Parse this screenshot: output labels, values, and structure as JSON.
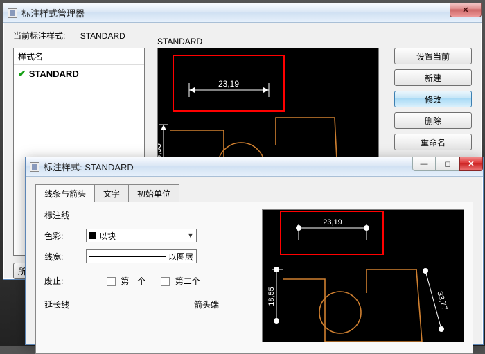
{
  "manager": {
    "title": "标注样式管理器",
    "current_label": "当前标注样式:",
    "current_value": "STANDARD",
    "style_col_header": "样式名",
    "styles": [
      {
        "name": "STANDARD",
        "active": true
      }
    ],
    "preview_label": "STANDARD",
    "buttons": {
      "set_current": "设置当前",
      "new": "新建",
      "modify": "修改",
      "delete": "删除",
      "rename": "重命名"
    },
    "all_button": "所有"
  },
  "editor": {
    "title": "标注样式: STANDARD",
    "tabs": {
      "lines": "线条与箭头",
      "text": "文字",
      "units": "初始单位"
    },
    "group_lines": "标注线",
    "color_label": "色彩:",
    "color_value": "以块",
    "lineweight_label": "线宽:",
    "lineweight_value": "以图层",
    "suppress_label": "废止:",
    "suppress_first": "第一个",
    "suppress_second": "第二个",
    "group_ext": "延长线",
    "group_arrow": "箭头端"
  },
  "preview_dims": {
    "horizontal": "23,19",
    "vertical": "18,55",
    "diagonal": "33,77"
  },
  "icons": {
    "close": "✕",
    "min": "—",
    "max": "◻",
    "dropdown": "▼",
    "check": "✔"
  }
}
